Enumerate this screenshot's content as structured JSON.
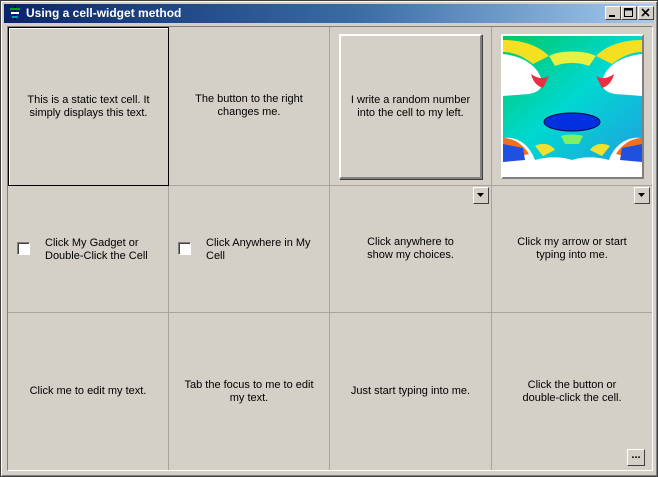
{
  "window": {
    "title": "Using a cell-widget method",
    "icon": "app-tree-icon"
  },
  "title_buttons": [
    "minimize-icon",
    "maximize-icon",
    "close-icon"
  ],
  "colors": {
    "titlebar_start": "#0a246a",
    "titlebar_end": "#a6caf0",
    "face": "#d4d0c8"
  },
  "row1": {
    "static_text": "This is a static text cell.  It simply displays this text.",
    "changed_text": "The button to the right changes me.",
    "random_button_label": "I write a random number into the cell to my left.",
    "image_description": "surface-plot-image"
  },
  "row2": {
    "gadget_checkbox_label": "Click My Gadget or Double-Click the Cell",
    "anywhere_checkbox_label": "Click Anywhere in My Cell",
    "choices_text": "Click anywhere to show my choices.",
    "arrow_typing_text": "Click my arrow or start typing into me."
  },
  "row3": {
    "edit_text": "Click me to edit my text.",
    "tab_focus_text": "Tab the focus to me to edit my text.",
    "typing_text": "Just start typing into me.",
    "button_dblclick_text": "Click the button or double-click the cell.",
    "ellipsis_label": "..."
  }
}
